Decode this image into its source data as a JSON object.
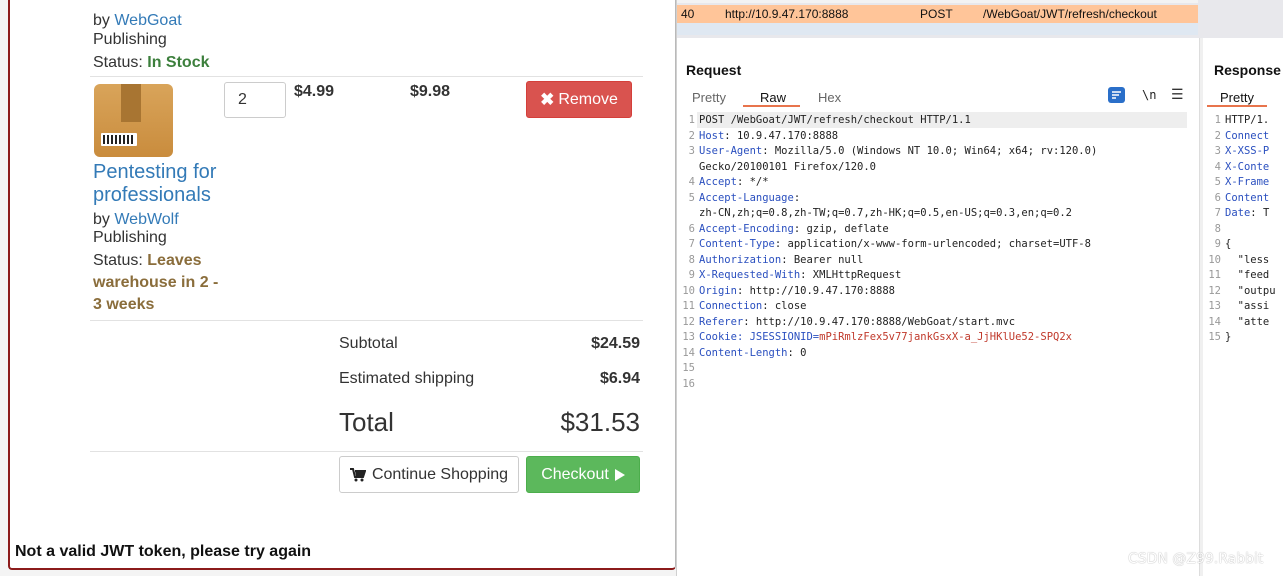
{
  "cart": {
    "item1": {
      "by_prefix": "by",
      "publisher_line1": "WebGoat",
      "publisher_line2": "Publishing",
      "status_label": "Status:",
      "status_value": "In Stock"
    },
    "item2": {
      "quantity": "2",
      "unit_price": "$4.99",
      "line_total": "$9.98",
      "remove_label": "Remove",
      "title_line1": "Pentesting for",
      "title_line2": "professionals",
      "by_prefix": "by",
      "publisher_line1": "WebWolf",
      "publisher_line2": "Publishing",
      "status_label": "Status:",
      "status_line1": "Leaves",
      "status_line2": "warehouse in 2 -",
      "status_line3": "3 weeks"
    },
    "summary": {
      "subtotal_label": "Subtotal",
      "subtotal_value": "$24.59",
      "shipping_label": "Estimated shipping",
      "shipping_value": "$6.94",
      "total_label": "Total",
      "total_value": "$31.53"
    },
    "buttons": {
      "continue_label": "Continue Shopping",
      "checkout_label": "Checkout"
    },
    "message": "Not a valid JWT token, please try again"
  },
  "burp": {
    "history_row": {
      "id": "40",
      "host": "http://10.9.47.170:8888",
      "method": "POST",
      "url": "/WebGoat/JWT/refresh/checkout"
    },
    "request": {
      "title": "Request",
      "tabs": [
        "Pretty",
        "Raw",
        "Hex"
      ],
      "active_tab": "Raw",
      "newline_toggle": "\\n",
      "lines": [
        {
          "n": "1",
          "name": "",
          "value": "POST /WebGoat/JWT/refresh/checkout HTTP/1.1"
        },
        {
          "n": "2",
          "name": "Host",
          "value": ": 10.9.47.170:8888"
        },
        {
          "n": "3",
          "name": "User-Agent",
          "value": ": Mozilla/5.0 (Windows NT 10.0; Win64; x64; rv:120.0)"
        },
        {
          "n": "",
          "name": "",
          "value": "Gecko/20100101 Firefox/120.0"
        },
        {
          "n": "4",
          "name": "Accept",
          "value": ": */*"
        },
        {
          "n": "5",
          "name": "Accept-Language",
          "value": ":"
        },
        {
          "n": "",
          "name": "",
          "value": "zh-CN,zh;q=0.8,zh-TW;q=0.7,zh-HK;q=0.5,en-US;q=0.3,en;q=0.2"
        },
        {
          "n": "6",
          "name": "Accept-Encoding",
          "value": ": gzip, deflate"
        },
        {
          "n": "7",
          "name": "Content-Type",
          "value": ": application/x-www-form-urlencoded; charset=UTF-8"
        },
        {
          "n": "8",
          "name": "Authorization",
          "value": ": Bearer null"
        },
        {
          "n": "9",
          "name": "X-Requested-With",
          "value": ": XMLHttpRequest"
        },
        {
          "n": "10",
          "name": "Origin",
          "value": ": http://10.9.47.170:8888"
        },
        {
          "n": "11",
          "name": "Connection",
          "value": ": close"
        },
        {
          "n": "12",
          "name": "Referer",
          "value": ": http://10.9.47.170:8888/WebGoat/start.mvc"
        },
        {
          "n": "13",
          "name": "Cookie",
          "value": ": JSESSIONID=",
          "cookie": "mPiRmlzFex5v77jankGsxX-a_JjHKlUe52-SPQ2x"
        },
        {
          "n": "14",
          "name": "Content-Length",
          "value": ": 0"
        },
        {
          "n": "15",
          "name": "",
          "value": ""
        },
        {
          "n": "16",
          "name": "",
          "value": ""
        }
      ]
    },
    "response": {
      "title": "Response",
      "tabs": [
        "Pretty"
      ],
      "lines": [
        {
          "n": "1",
          "name": "",
          "value": "HTTP/1."
        },
        {
          "n": "2",
          "name": "Connect",
          "value": ""
        },
        {
          "n": "3",
          "name": "X-XSS-P",
          "value": ""
        },
        {
          "n": "4",
          "name": "X-Conte",
          "value": ""
        },
        {
          "n": "5",
          "name": "X-Frame",
          "value": ""
        },
        {
          "n": "6",
          "name": "Content",
          "value": ""
        },
        {
          "n": "7",
          "name": "Date",
          "value": ": T"
        },
        {
          "n": "8",
          "name": "",
          "value": ""
        },
        {
          "n": "9",
          "name": "",
          "value": "{"
        },
        {
          "n": "10",
          "name": "",
          "value": "  \"less"
        },
        {
          "n": "11",
          "name": "",
          "value": "  \"feed"
        },
        {
          "n": "12",
          "name": "",
          "value": "  \"outpu"
        },
        {
          "n": "13",
          "name": "",
          "value": "  \"assi"
        },
        {
          "n": "14",
          "name": "",
          "value": "  \"atte"
        },
        {
          "n": "15",
          "name": "",
          "value": "}"
        }
      ]
    }
  },
  "watermark": "CSDN @Z99.Rabbit",
  "colors": {
    "link": "#337ab7",
    "danger": "#d9534f",
    "success": "#5cb85c",
    "history_highlight": "#ffc599",
    "burp_accent": "#e8744c",
    "header_name": "#2a4fbf"
  }
}
